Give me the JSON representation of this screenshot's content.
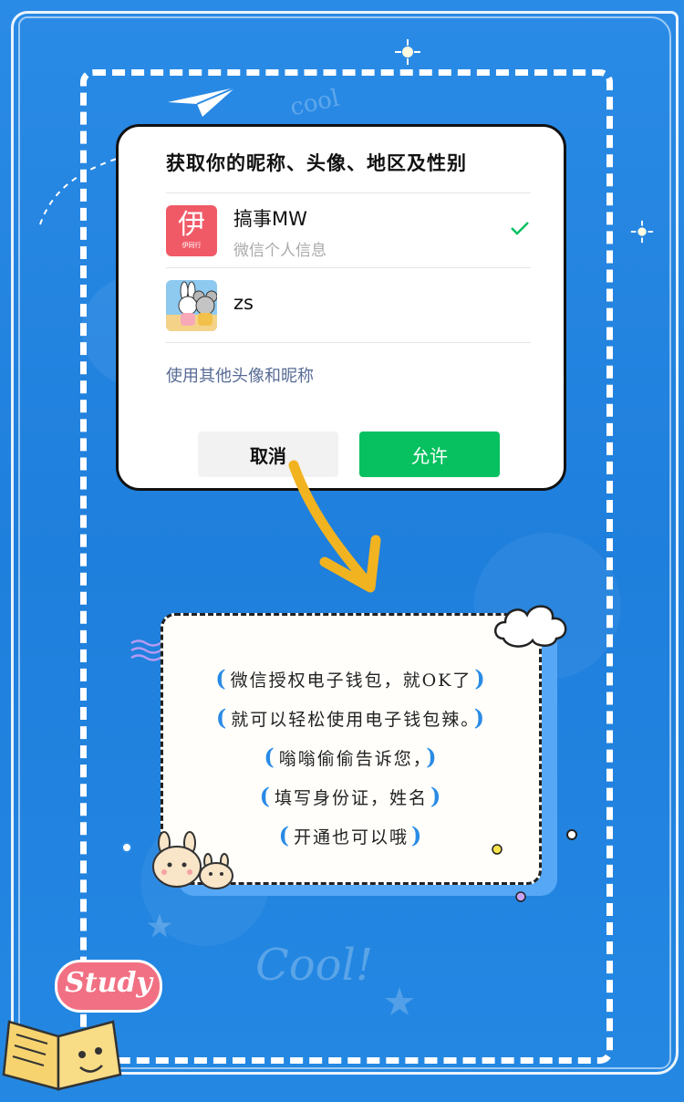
{
  "dialog": {
    "title": "获取你的昵称、头像、地区及性别",
    "options": [
      {
        "name": "搞事MW",
        "subtitle": "微信个人信息",
        "selected": true,
        "avatar_glyph": "伊",
        "avatar_caption": "伊同行"
      },
      {
        "name": "zs",
        "subtitle": "",
        "selected": false
      }
    ],
    "other_link": "使用其他头像和昵称",
    "cancel_label": "取消",
    "allow_label": "允许"
  },
  "note": {
    "lines": [
      "微信授权电子钱包，就OK了",
      "就可以轻松使用电子钱包辣。",
      "嗡嗡偷偷告诉您，",
      "填写身份证，姓名",
      "开通也可以哦"
    ]
  },
  "decor": {
    "study_text": "Study",
    "cool_text": "cool",
    "cool_text_2": "Cool!"
  },
  "colors": {
    "background": "#1f7fdc",
    "allow_button": "#07c160",
    "link": "#576b95",
    "check": "#07c160",
    "note_bracket": "#2a8be6",
    "study_bubble": "#f27083"
  }
}
